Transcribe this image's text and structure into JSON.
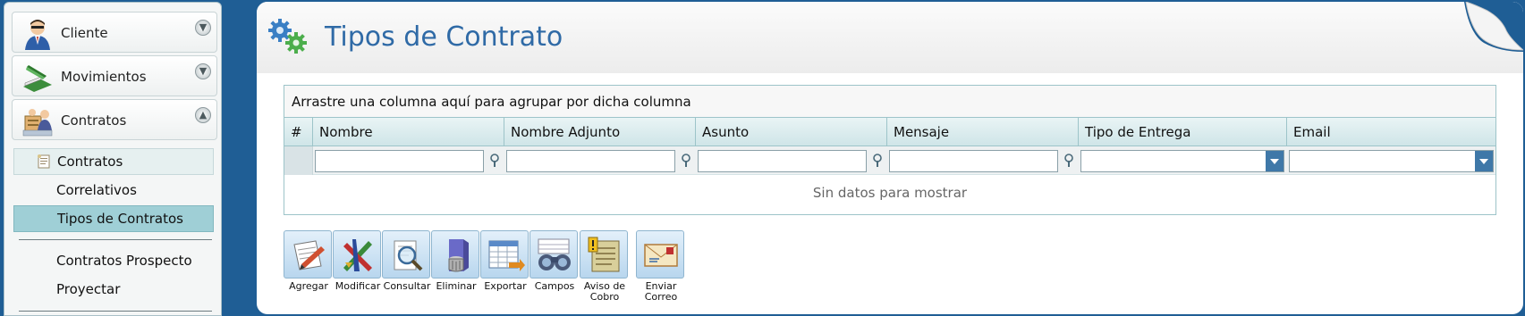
{
  "sidebar": {
    "sections": [
      {
        "label": "Cliente",
        "icon": "user-icon",
        "toggle": "expand-icon"
      },
      {
        "label": "Movimientos",
        "icon": "scanner-icon",
        "toggle": "expand-icon"
      },
      {
        "label": "Contratos",
        "icon": "contracts-icon",
        "toggle": "collapse-icon"
      }
    ],
    "contratos_items": [
      {
        "label": "Contratos",
        "state": "hover"
      },
      {
        "label": "Correlativos",
        "state": "normal"
      },
      {
        "label": "Tipos de Contratos",
        "state": "selected"
      }
    ],
    "extra_items": [
      {
        "label": "Contratos Prospecto"
      },
      {
        "label": "Proyectar"
      }
    ]
  },
  "page": {
    "title": "Tipos de Contrato",
    "icon": "gears-icon"
  },
  "grid": {
    "group_hint": "Arrastre una columna aquí para agrupar por dicha columna",
    "columns": [
      "#",
      "Nombre",
      "Nombre Adjunto",
      "Asunto",
      "Mensaje",
      "Tipo de Entrega",
      "Email"
    ],
    "empty_text": "Sin datos para mostrar"
  },
  "toolbar": {
    "buttons": [
      {
        "label": "Agregar",
        "icon": "add-document-icon"
      },
      {
        "label": "Modificar",
        "icon": "edit-pencils-icon"
      },
      {
        "label": "Consultar",
        "icon": "magnifier-icon"
      },
      {
        "label": "Eliminar",
        "icon": "trash-icon"
      },
      {
        "label": "Exportar",
        "icon": "export-sheet-icon"
      },
      {
        "label": "Campos",
        "icon": "binoculars-icon"
      },
      {
        "label": "Aviso de\nCobro",
        "icon": "notice-icon"
      },
      {
        "label": "Enviar\nCorreo",
        "icon": "envelope-icon"
      }
    ]
  },
  "colors": {
    "background": "#1f5e95",
    "title": "#2f6aa6",
    "selected_item": "#9fcfd6",
    "grid_border": "#9dc4c9",
    "dropdown_arrow": "#3f78a8"
  }
}
